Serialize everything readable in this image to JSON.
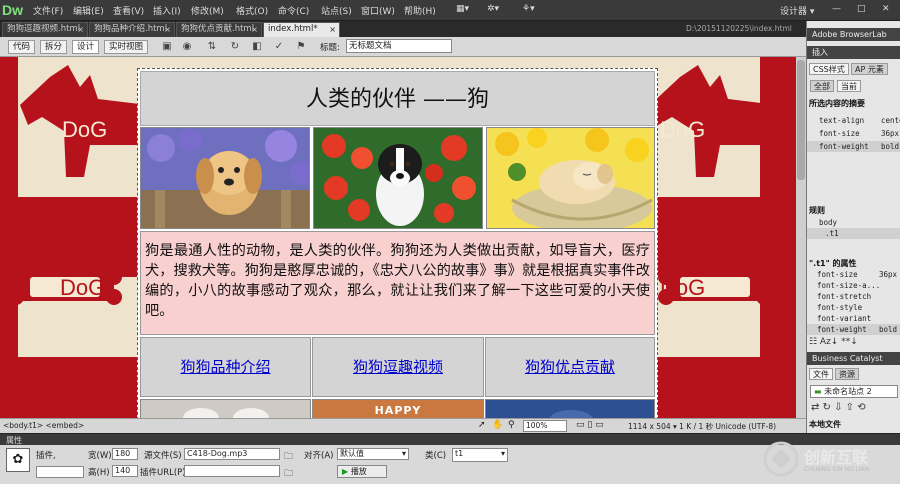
{
  "app": {
    "logo": "Dw",
    "workspace": "设计器 ▾"
  },
  "menu": [
    "文件(F)",
    "编辑(E)",
    "查看(V)",
    "插入(I)",
    "修改(M)",
    "格式(O)",
    "命令(C)",
    "站点(S)",
    "窗口(W)",
    "帮助(H)"
  ],
  "top_right": {
    "window_controls": [
      "—",
      "□",
      "✕"
    ]
  },
  "tabs": [
    {
      "label": "狗狗逗趣视频.html",
      "active": false
    },
    {
      "label": "狗狗品种介绍.html",
      "active": false
    },
    {
      "label": "狗狗优点贡献.html",
      "active": false
    },
    {
      "label": "index.html*",
      "active": true
    }
  ],
  "file_path": "D:\\20151120225\\index.html",
  "toolbar": {
    "code": "代码",
    "split": "拆分",
    "design": "设计",
    "live": "实时视图",
    "title_label": "标题:",
    "title_value": "无标题文档"
  },
  "page": {
    "heading": "人类的伙伴 ——狗",
    "paragraph": "狗是最通人性的动物，是人类的伙伴。狗狗还为人类做出贡献，如导盲犬，医疗犬，搜救犬等。狗狗是憨厚忠诚的，《忠犬八公的故事》事》就是根据真实事件改编的，小八的故事感动了观众，那么，就让让我们来了解一下这些可爱的小天使吧。",
    "links": [
      "狗狗品种介绍",
      "狗狗逗趣视频",
      "狗狗优点贡献"
    ],
    "bottom_banner_text": "HAPPY",
    "background_word": "DoG"
  },
  "statusbar": {
    "tags": "<body.t1> <embed>",
    "zoom": "100%",
    "info": "1114 x 504 ▾ 1 K / 1 秒  Unicode (UTF-8)"
  },
  "properties": {
    "header": "属性",
    "plugin_label": "插件,",
    "width_label": "宽(W)",
    "width_value": "180",
    "height_label": "高(H)",
    "height_value": "140",
    "src_label": "源文件(S)",
    "src_value": "C418-Dog.mp3",
    "plugin_url_label": "插件URL(P)",
    "align_label": "对齐(A)",
    "align_value": "默认值",
    "class_label": "类(C)",
    "class_value": "t1",
    "play_button": "播放"
  },
  "right_panel": {
    "browserlab": "Adobe BrowserLab",
    "insert": "插入",
    "css_tabs": [
      "CSS样式",
      "AP 元素"
    ],
    "mode_tabs": [
      "全部",
      "当前"
    ],
    "summary_heading": "所选内容的摘要",
    "summary_rows": [
      {
        "prop": "text-align",
        "val": "center"
      },
      {
        "prop": "font-size",
        "val": "36px"
      },
      {
        "prop": "font-weight",
        "val": "bold"
      }
    ],
    "rules_heading": "规则",
    "rules": [
      "body",
      ".t1"
    ],
    "props_heading": "\".t1\" 的属性",
    "prop_rows": [
      {
        "prop": "font-size",
        "val": "36px"
      },
      {
        "prop": "font-size-a...",
        "val": ""
      },
      {
        "prop": "font-stretch",
        "val": ""
      },
      {
        "prop": "font-style",
        "val": ""
      },
      {
        "prop": "font-variant",
        "val": ""
      },
      {
        "prop": "font-weight",
        "val": "bold"
      }
    ],
    "business": "Business Catalyst",
    "file_tabs": [
      "文件",
      "资源"
    ],
    "site_value": "未命名站点 2",
    "local_files": "本地文件"
  },
  "watermark": {
    "brand": "创新互联",
    "sub": "CHUANG XIN HU LIAN"
  },
  "colors": {
    "dog_red": "#b5121b",
    "canvas_bg": "#e8dcc5",
    "para_bg": "#f9d0d0",
    "link": "#0000cc"
  }
}
